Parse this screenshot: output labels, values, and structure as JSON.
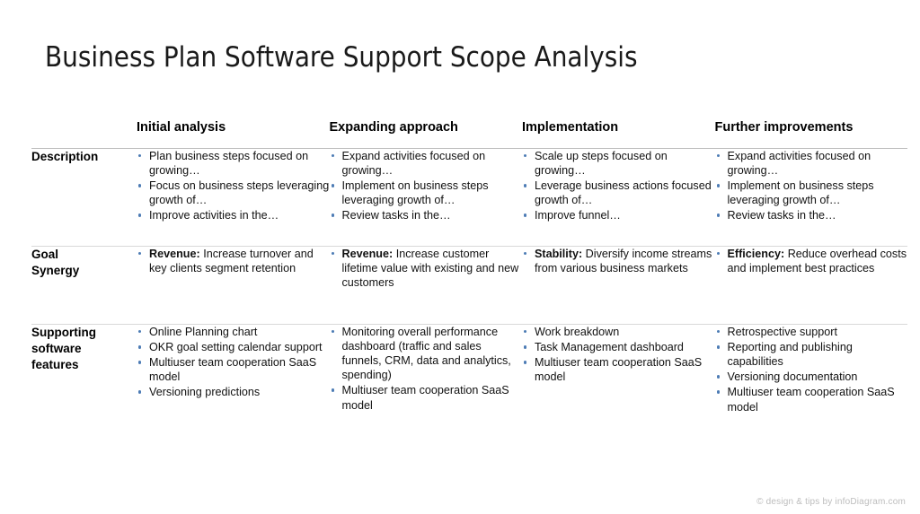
{
  "slide": {
    "title": "Business Plan Software Support Scope Analysis",
    "footer_credit": "© design & tips by infoDiagram.com",
    "bullet_color": "#4d7cb5",
    "divider_color": "#d9d9d9",
    "header_divider_color": "#bfbfbf"
  },
  "matrix": {
    "corner_label": "",
    "columns": [
      {
        "label": "Initial analysis"
      },
      {
        "label": "Expanding approach"
      },
      {
        "label": "Implementation"
      },
      {
        "label": "Further improvements"
      }
    ],
    "rows": [
      {
        "label": "Description",
        "cells": [
          {
            "bullets": [
              {
                "lead": "",
                "text": "Plan business steps focused on growing…"
              },
              {
                "lead": "",
                "text": "Focus on business steps leveraging growth of…"
              },
              {
                "lead": "",
                "text": "Improve activities in the…"
              }
            ]
          },
          {
            "bullets": [
              {
                "lead": "",
                "text": "Expand activities focused on growing…"
              },
              {
                "lead": "",
                "text": "Implement on business steps leveraging growth of…"
              },
              {
                "lead": "",
                "text": "Review tasks in the…"
              }
            ]
          },
          {
            "bullets": [
              {
                "lead": "",
                "text": "Scale up steps focused on growing…"
              },
              {
                "lead": "",
                "text": "Leverage business actions focused growth of…"
              },
              {
                "lead": "",
                "text": "Improve funnel…"
              }
            ]
          },
          {
            "bullets": [
              {
                "lead": "",
                "text": "Expand activities focused on growing…"
              },
              {
                "lead": "",
                "text": "Implement on business steps leveraging growth of…"
              },
              {
                "lead": "",
                "text": "Review tasks in the…"
              }
            ]
          }
        ]
      },
      {
        "label": "Goal\nSynergy",
        "label_line1": "Goal",
        "label_line2": "Synergy",
        "cells": [
          {
            "bullets": [
              {
                "lead": "Revenue:",
                "text": " Increase turnover and key clients segment retention"
              }
            ]
          },
          {
            "bullets": [
              {
                "lead": "Revenue:",
                "text": " Increase customer lifetime value with existing and new customers"
              }
            ]
          },
          {
            "bullets": [
              {
                "lead": "Stability:",
                "text": " Diversify income streams from various business markets"
              }
            ]
          },
          {
            "bullets": [
              {
                "lead": "Efficiency:",
                "text": " Reduce overhead costs and implement best practices"
              }
            ]
          }
        ]
      },
      {
        "label": "Supporting software features",
        "label_line1": "Supporting",
        "label_line2": "software",
        "label_line3": "features",
        "cells": [
          {
            "bullets": [
              {
                "lead": "",
                "text": "Online Planning chart"
              },
              {
                "lead": "",
                "text": "OKR goal setting calendar support"
              },
              {
                "lead": "",
                "text": "Multiuser team cooperation SaaS model"
              },
              {
                "lead": "",
                "text": "Versioning predictions"
              }
            ]
          },
          {
            "bullets": [
              {
                "lead": "",
                "text": "Monitoring overall performance dashboard (traffic and sales funnels, CRM,  data and analytics, spending)"
              },
              {
                "lead": "",
                "text": "Multiuser team cooperation SaaS model"
              }
            ]
          },
          {
            "bullets": [
              {
                "lead": "",
                "text": "Work breakdown"
              },
              {
                "lead": "",
                "text": "Task Management dashboard"
              },
              {
                "lead": "",
                "text": "Multiuser team cooperation SaaS model"
              }
            ]
          },
          {
            "bullets": [
              {
                "lead": "",
                "text": "Retrospective support"
              },
              {
                "lead": "",
                "text": "Reporting and publishing capabilities"
              },
              {
                "lead": "",
                "text": "Versioning documentation"
              },
              {
                "lead": "",
                "text": "Multiuser team cooperation SaaS model"
              }
            ]
          }
        ]
      }
    ]
  }
}
